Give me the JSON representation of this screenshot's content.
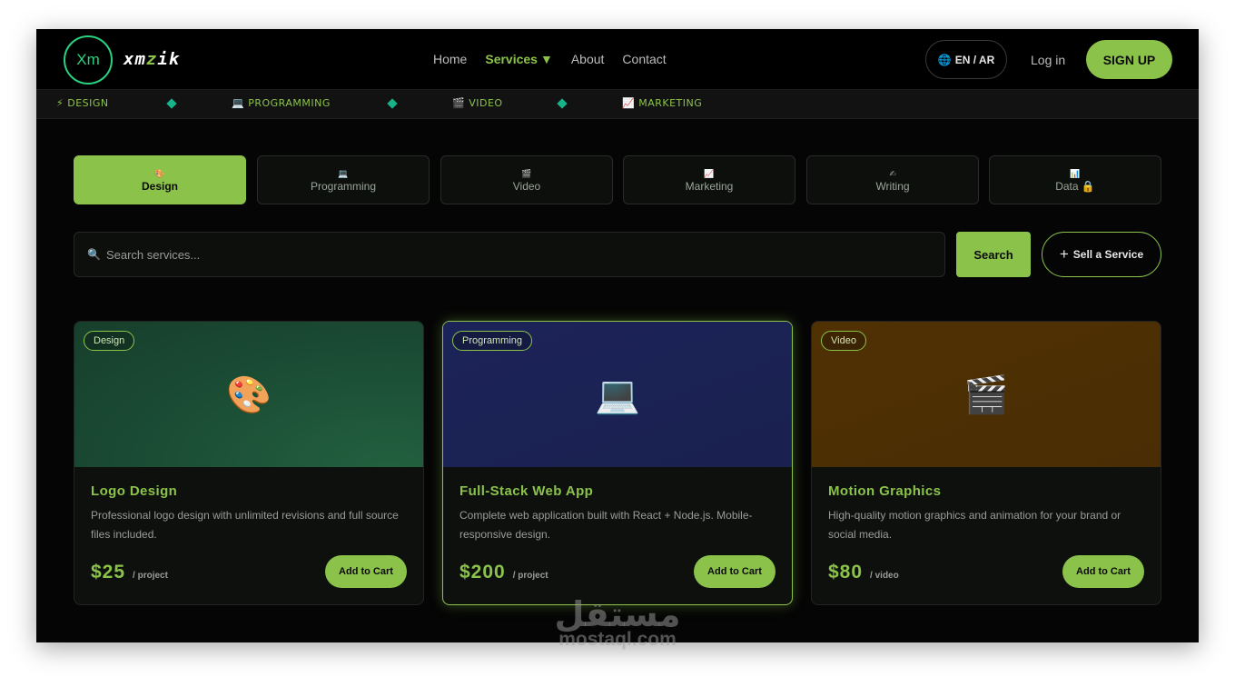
{
  "brand": {
    "mark": "Xm",
    "name_pre": "xm",
    "name_accent": "z",
    "name_post": "ik"
  },
  "nav": {
    "home": "Home",
    "services": "Services",
    "about": "About",
    "contact": "Contact"
  },
  "header": {
    "lang": "EN / AR",
    "login": "Log in",
    "signup": "SIGN UP"
  },
  "ticker": [
    {
      "icon": "⚡",
      "label": "DESIGN"
    },
    {
      "icon": "💻",
      "label": "PROGRAMMING"
    },
    {
      "icon": "🎬",
      "label": "VIDEO"
    },
    {
      "icon": "📈",
      "label": "MARKETING"
    }
  ],
  "tabs": [
    {
      "icon": "🎨",
      "label": "Design",
      "active": true
    },
    {
      "icon": "💻",
      "label": "Programming"
    },
    {
      "icon": "🎬",
      "label": "Video"
    },
    {
      "icon": "📈",
      "label": "Marketing"
    },
    {
      "icon": "✍",
      "label": "Writing"
    },
    {
      "icon": "📊",
      "label": "Data 🔒"
    }
  ],
  "search": {
    "icon": "🔍",
    "placeholder": "Search services...",
    "button": "Search",
    "sell_plus": "+",
    "sell_label": "Sell a Service"
  },
  "cards": [
    {
      "badge": "Design",
      "emoji": "🎨",
      "title": "Logo Design",
      "desc": "Professional logo design with unlimited revisions and full source files included.",
      "price": "$25",
      "unit": "/ project",
      "cta": "Add to Cart",
      "bg": "#1a4a33"
    },
    {
      "badge": "Programming",
      "emoji": "💻",
      "title": "Full-Stack Web App",
      "desc": "Complete web application built with React + Node.js. Mobile-responsive design.",
      "price": "$200",
      "unit": "/ project",
      "cta": "Add to Cart",
      "bg": "#1a2150"
    },
    {
      "badge": "Video",
      "emoji": "🎬",
      "title": "Motion Graphics",
      "desc": "High-quality motion graphics and animation for your brand or social media.",
      "price": "$80",
      "unit": "/ video",
      "cta": "Add to Cart",
      "bg": "#4a2d04"
    }
  ],
  "watermark": {
    "ar": "مستقل",
    "en": "mostaql.com"
  },
  "colors": {
    "accent": "#8bc34a",
    "logo_ring": "#2ad17f",
    "diamond": "#17b48a"
  }
}
